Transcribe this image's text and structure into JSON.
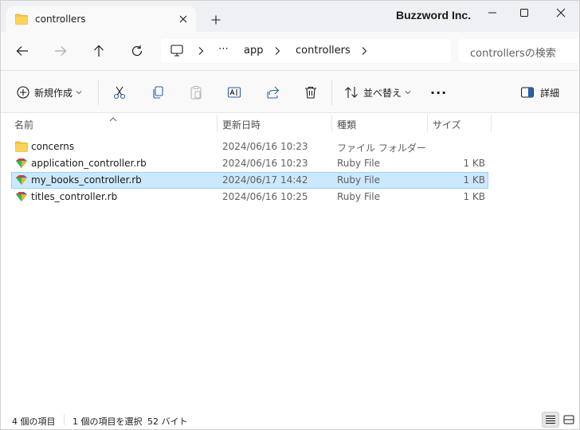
{
  "window": {
    "tab_title": "controllers",
    "brand": "Buzzword Inc.",
    "icons": {
      "tab": "folder-icon",
      "close_tab": "close-icon",
      "new_tab": "plus-icon",
      "minimize": "minimize-icon",
      "maximize": "maximize-icon",
      "close": "close-icon"
    }
  },
  "nav": {
    "buttons": [
      "back-icon",
      "forward-icon",
      "up-icon",
      "refresh-icon"
    ],
    "breadcrumb": {
      "root_icon": "computer-icon",
      "overflow": "⋯",
      "items": [
        "app",
        "controllers"
      ]
    },
    "search_placeholder": "controllersの検索"
  },
  "toolbar": {
    "new_label": "新規作成",
    "sort_label": "並べ替え",
    "details_label": "詳細",
    "actions": [
      "cut-icon",
      "copy-icon",
      "paste-icon",
      "rename-icon",
      "share-icon",
      "delete-icon"
    ],
    "more": "..."
  },
  "columns": {
    "name": "名前",
    "date": "更新日時",
    "type": "種類",
    "size": "サイズ"
  },
  "files": [
    {
      "name": "concerns",
      "date": "2024/06/16 10:23",
      "type": "ファイル フォルダー",
      "size": "",
      "icon": "folder-icon"
    },
    {
      "name": "application_controller.rb",
      "date": "2024/06/16 10:23",
      "type": "Ruby File",
      "size": "1 KB",
      "icon": "ruby-file-icon"
    },
    {
      "name": "my_books_controller.rb",
      "date": "2024/06/17 14:42",
      "type": "Ruby File",
      "size": "1 KB",
      "icon": "ruby-file-icon",
      "selected": true
    },
    {
      "name": "titles_controller.rb",
      "date": "2024/06/16 10:25",
      "type": "Ruby File",
      "size": "1 KB",
      "icon": "ruby-file-icon"
    }
  ],
  "status": {
    "item_count": "4 個の項目",
    "selection": "1 個の項目を選択",
    "selection_size": "52 バイト"
  },
  "colors": {
    "accent": "#0067c0",
    "selected_bg": "#cce8ff",
    "folder": "#f8c73e"
  }
}
